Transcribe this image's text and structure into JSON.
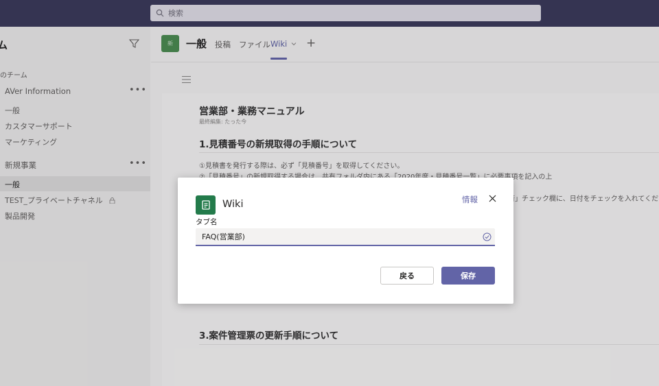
{
  "search": {
    "placeholder": "検索"
  },
  "left": {
    "teams_title": "ム",
    "section_label": "のチーム",
    "teams": [
      {
        "name": "AVer Information",
        "more": "•••",
        "channels": [
          "一般",
          "カスタマーサポート",
          "マーケティング"
        ]
      },
      {
        "name": "新規事業",
        "more": "•••",
        "channels": [
          "一般",
          "TEST_プライベートチャネル",
          "製品開発"
        ]
      }
    ]
  },
  "channel": {
    "avatar_text": "新",
    "title": "一般",
    "tabs": [
      "投稿",
      "ファイル",
      "Wiki"
    ],
    "active_tab": "Wiki",
    "plus": "+"
  },
  "wiki": {
    "page_title": "営業部・業務マニュアル",
    "last_edited": "最終編集: たった今",
    "section1": "1.見積番号の新規取得の手順について",
    "line1": "①見積書を発行する際は、必ず「見積番号」を取得してください。",
    "line2": "②「見積番号」の新規取得する場合は、共有フォルダ内にある「2020年度・見積番号一覧」に必要事項を記入の上",
    "line3": "済」チェック欄に、日付をチェックを入れてください",
    "section3": "3.案件管理票の更新手順について"
  },
  "dialog": {
    "title": "Wiki",
    "info_link": "情報",
    "field_label": "タブ名",
    "field_value": "FAQ(営業部)",
    "back_button": "戻る",
    "save_button": "保存"
  },
  "colors": {
    "topbar": "#3b3a59",
    "accent": "#6264a7",
    "wiki_icon": "#237b4b",
    "team_avatar": "#4b8b4f"
  }
}
